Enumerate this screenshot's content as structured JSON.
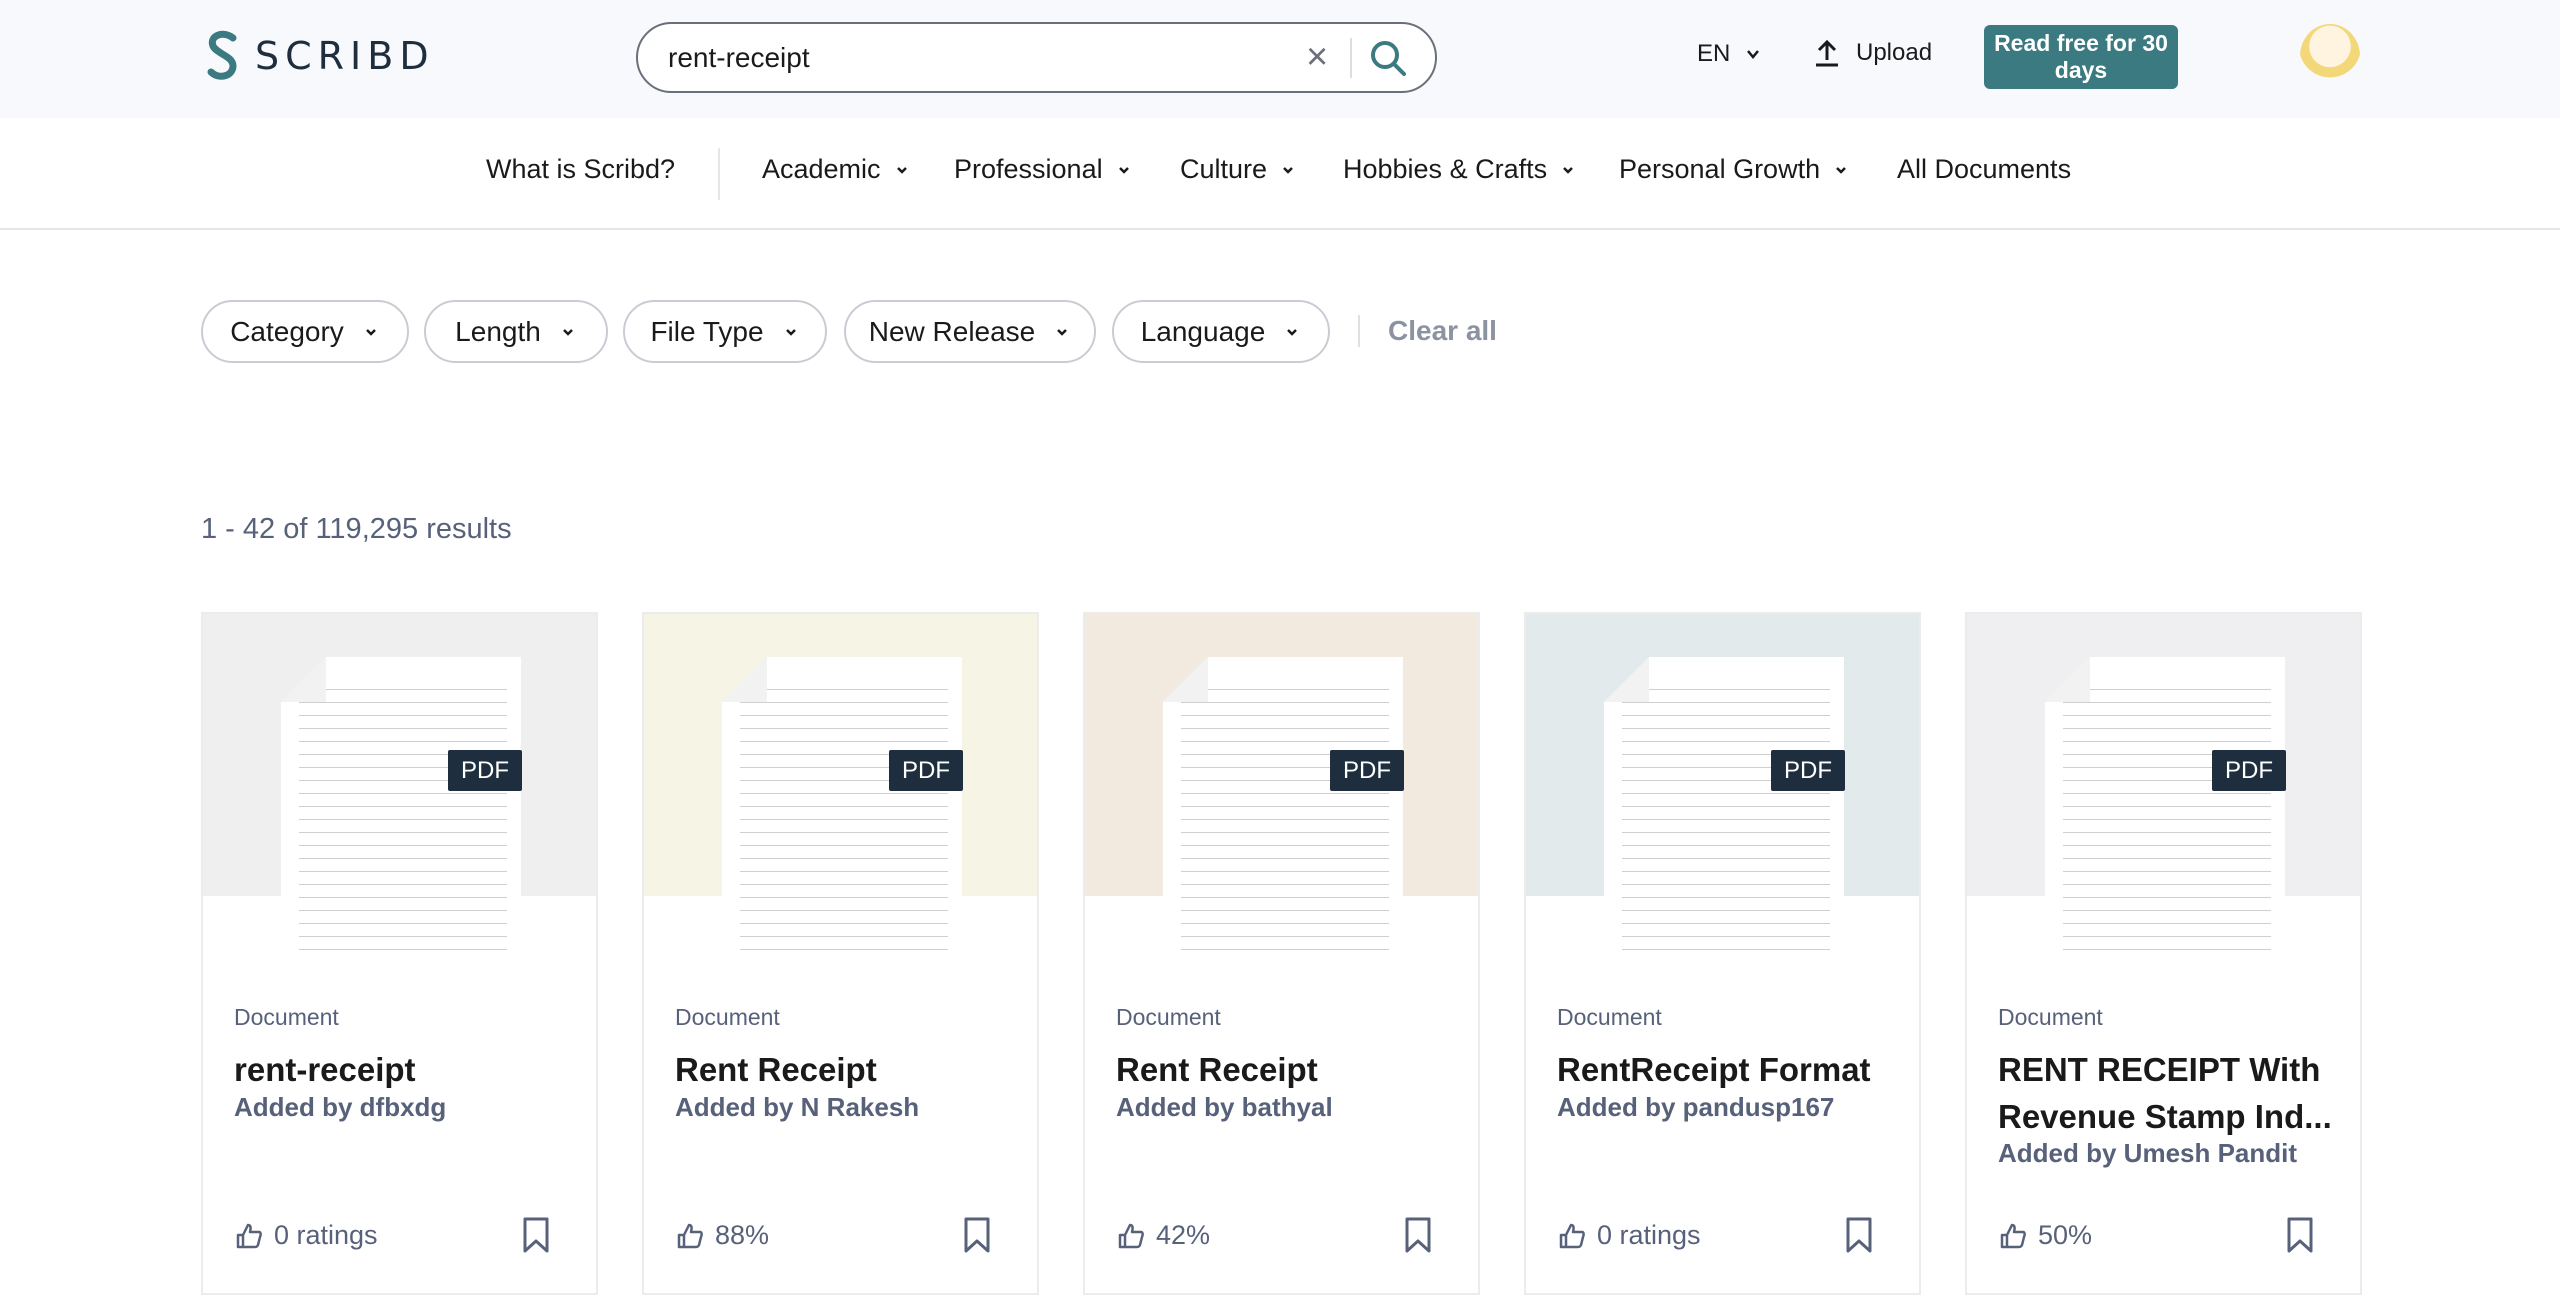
{
  "header": {
    "logo_text": "SCRIBD",
    "search_value": "rent-receipt",
    "language": "EN",
    "upload_label": "Upload",
    "cta_label": "Read free for 30 days",
    "brand_color": "#3a7a80"
  },
  "nav": {
    "items": [
      {
        "label": "What is Scribd?"
      },
      {
        "label": "Academic"
      },
      {
        "label": "Professional"
      },
      {
        "label": "Culture"
      },
      {
        "label": "Hobbies & Crafts"
      },
      {
        "label": "Personal Growth"
      },
      {
        "label": "All Documents"
      }
    ]
  },
  "filters": {
    "items": [
      {
        "label": "Category"
      },
      {
        "label": "Length"
      },
      {
        "label": "File Type"
      },
      {
        "label": "New Release"
      },
      {
        "label": "Language"
      }
    ],
    "clear_label": "Clear all"
  },
  "results": {
    "summary": "1 - 42 of 119,295 results"
  },
  "cards": [
    {
      "type": "Document",
      "title": "rent-receipt",
      "author": "Added by dfbxdg",
      "rating": "0 ratings",
      "badge": "PDF",
      "thumb_bg": "#efefef"
    },
    {
      "type": "Document",
      "title": "Rent Receipt",
      "author": "Added by N Rakesh",
      "rating": "88%",
      "badge": "PDF",
      "thumb_bg": "#f6f4e4"
    },
    {
      "type": "Document",
      "title": "Rent Receipt",
      "author": "Added by bathyal",
      "rating": "42%",
      "badge": "PDF",
      "thumb_bg": "#f2eadf"
    },
    {
      "type": "Document",
      "title": "RentReceipt Format",
      "author": "Added by pandusp167",
      "rating": "0 ratings",
      "badge": "PDF",
      "thumb_bg": "#e3eaec"
    },
    {
      "type": "Document",
      "title": "RENT RECEIPT With Revenue Stamp Ind...",
      "author": "Added by Umesh Pandit",
      "rating": "50%",
      "badge": "PDF",
      "thumb_bg": "#efeff1"
    }
  ]
}
